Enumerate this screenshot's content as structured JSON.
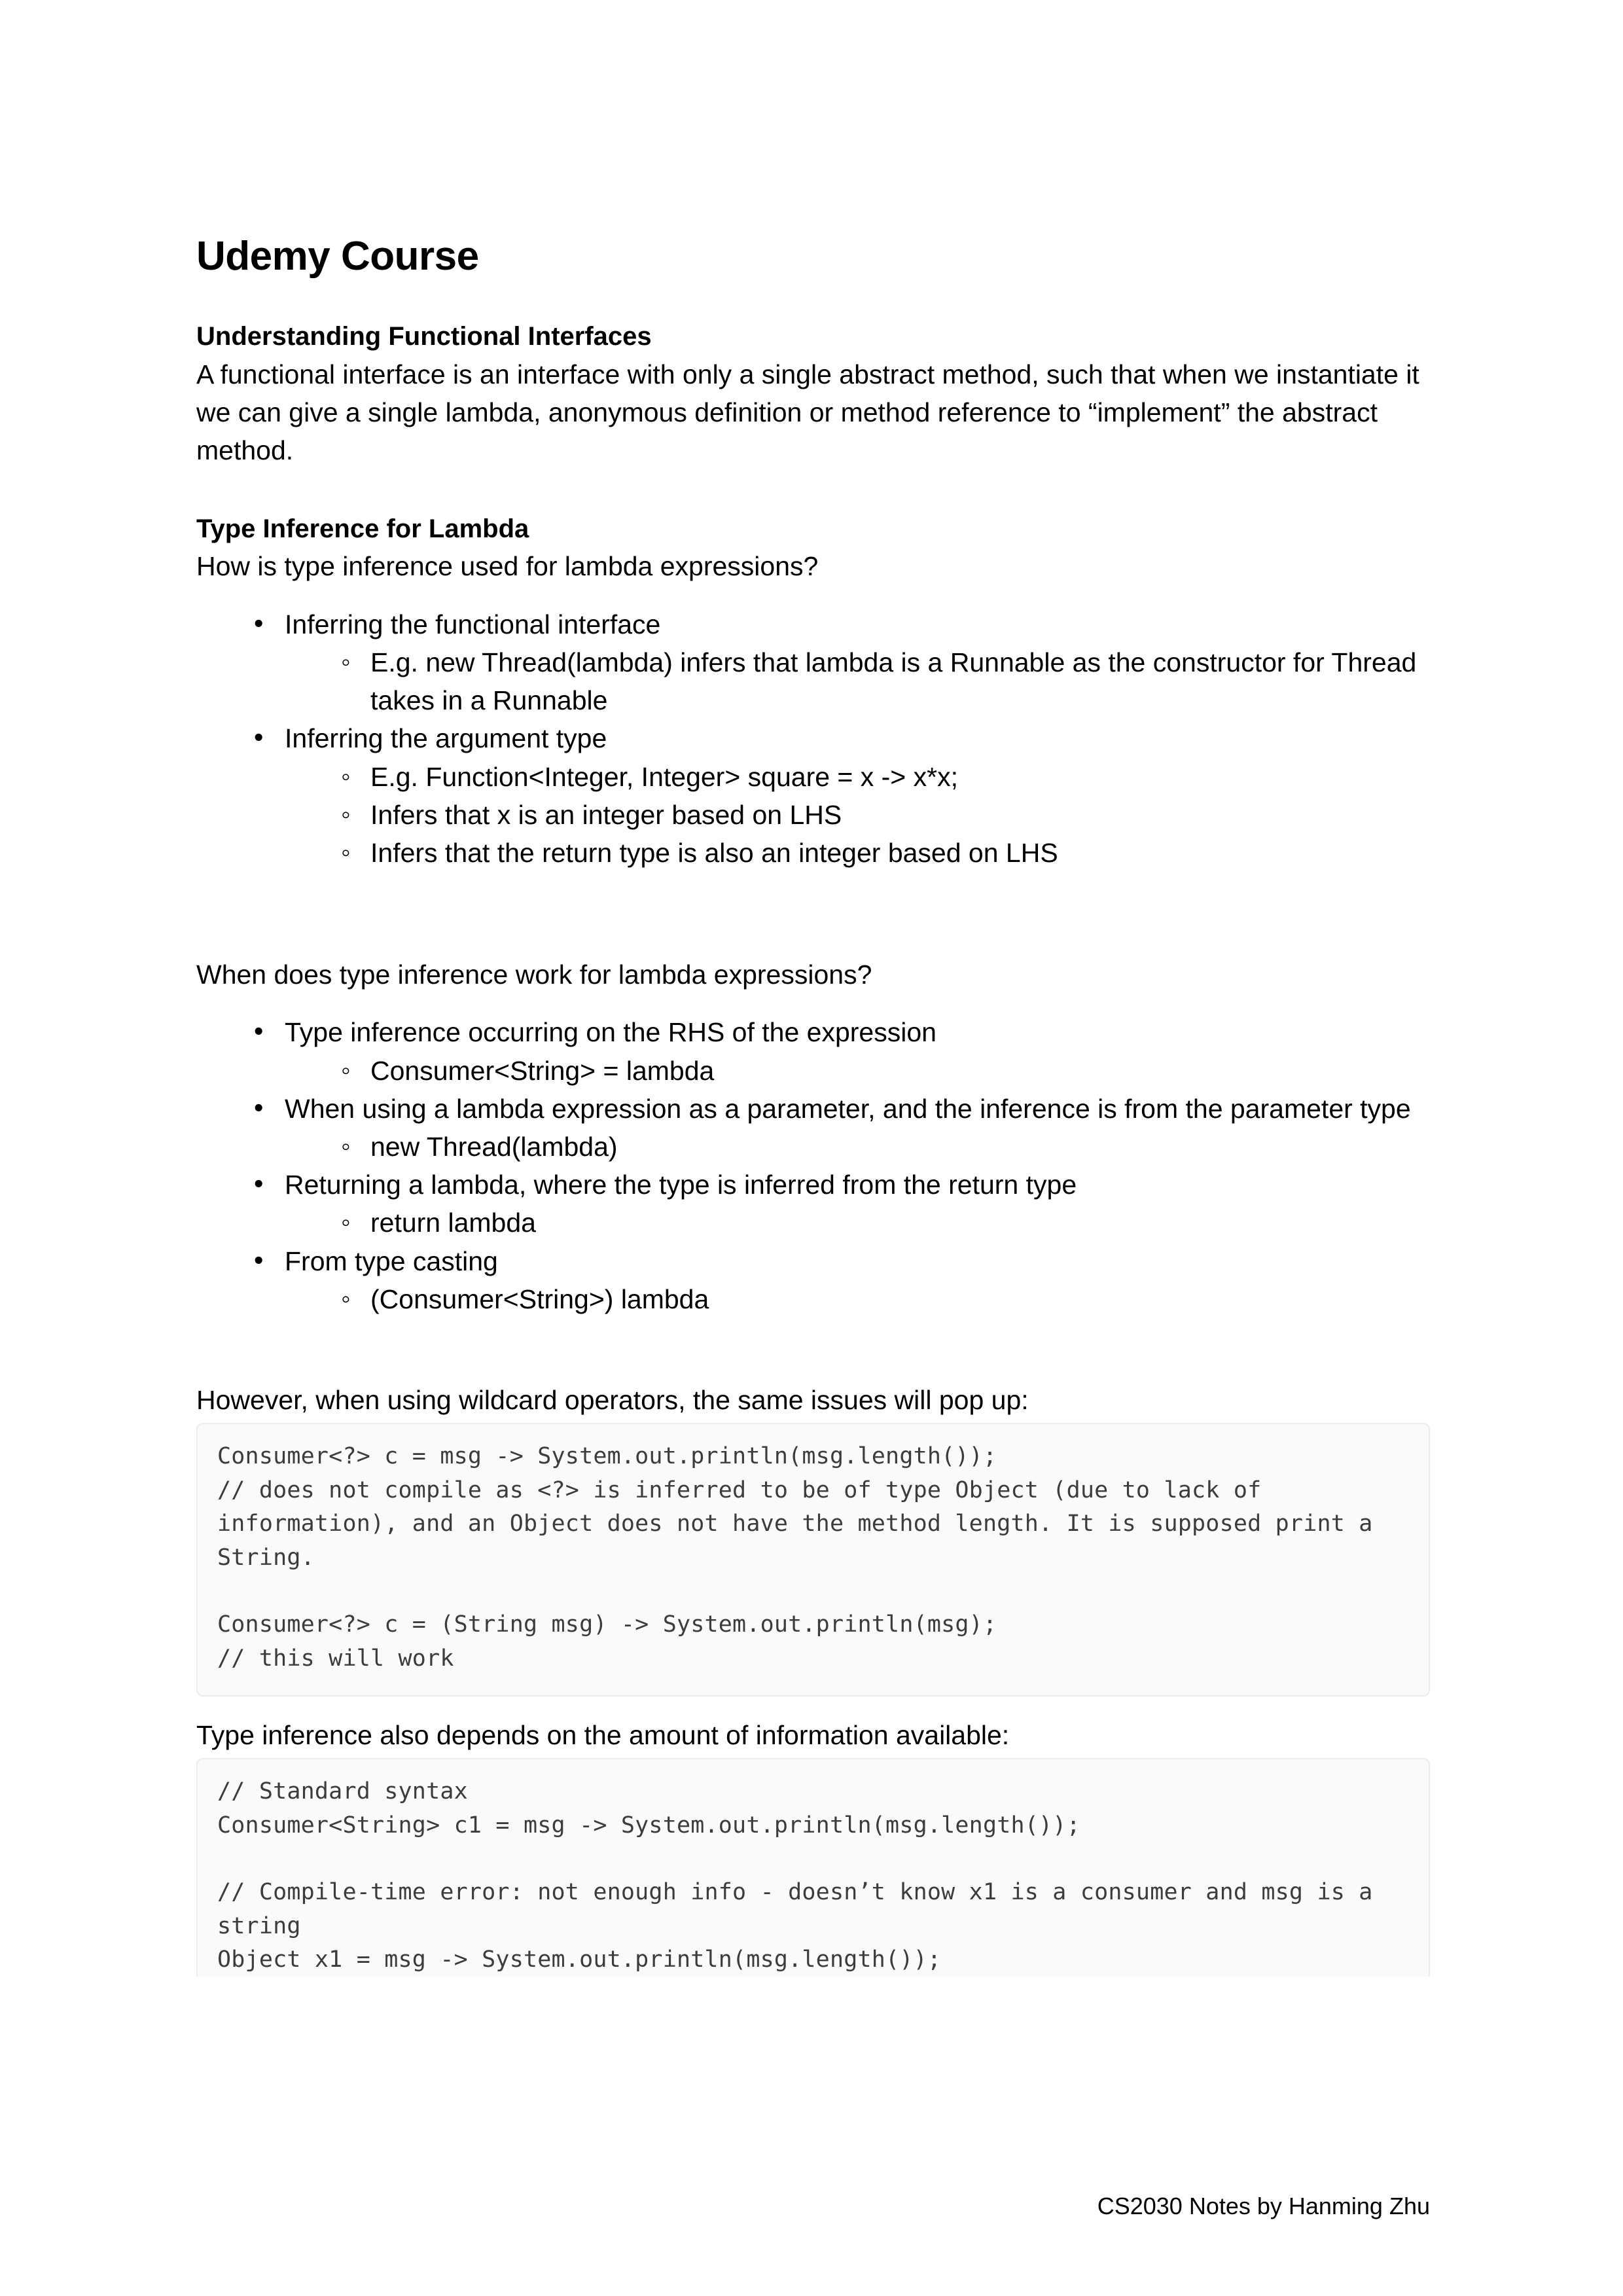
{
  "document": {
    "title": "Udemy Course",
    "footer": "CS2030 Notes by Hanming Zhu"
  },
  "sections": {
    "functional_interfaces": {
      "heading": "Understanding Functional Interfaces",
      "paragraph": "A functional interface is an interface with only a single abstract method, such that when we instantiate it we can give a single lambda, anonymous definition or method reference to “implement” the abstract method."
    },
    "type_inference": {
      "heading": "Type Inference for Lambda",
      "question_1": "How is type inference used for lambda expressions?",
      "list_1": [
        {
          "text": "Inferring the functional interface",
          "children": [
            "E.g. new Thread(lambda) infers that lambda is a Runnable as the constructor for Thread takes in a Runnable"
          ]
        },
        {
          "text": "Inferring the argument type",
          "children": [
            "E.g. Function<Integer, Integer> square = x -> x*x;",
            "Infers that x is an integer based on LHS",
            "Infers that the return type is also an integer based on LHS"
          ]
        }
      ],
      "question_2": "When does type inference work for lambda expressions?",
      "list_2": [
        {
          "text": "Type inference occurring on the RHS of the expression",
          "children": [
            "Consumer<String> = lambda"
          ]
        },
        {
          "text": "When using a lambda expression as a parameter, and the inference is from the parameter type",
          "children": [
            "new Thread(lambda)"
          ]
        },
        {
          "text": "Returning a lambda, where the type is inferred from the return type",
          "children": [
            "return lambda"
          ]
        },
        {
          "text": "From type casting",
          "children": [
            "(Consumer<String>) lambda"
          ]
        }
      ]
    },
    "wildcards": {
      "intro": "However, when using wildcard operators, the same issues will pop up:",
      "code": [
        "Consumer<?> c = msg -> System.out.println(msg.length());",
        "// does not compile as <?> is inferred to be of type Object (due to lack of information), and an Object does not have the method length. It is supposed print a String.",
        "",
        "Consumer<?> c = (String msg) -> System.out.println(msg);",
        "// this will work"
      ]
    },
    "information_amount": {
      "intro": "Type inference also depends on the amount of information available:",
      "code": [
        "// Standard syntax",
        "Consumer<String> c1 = msg -> System.out.println(msg.length());",
        "",
        "// Compile-time error: not enough info - doesn’t know x1 is a consumer and msg is a string",
        "Object x1 = msg -> System.out.println(msg.length());"
      ]
    }
  }
}
